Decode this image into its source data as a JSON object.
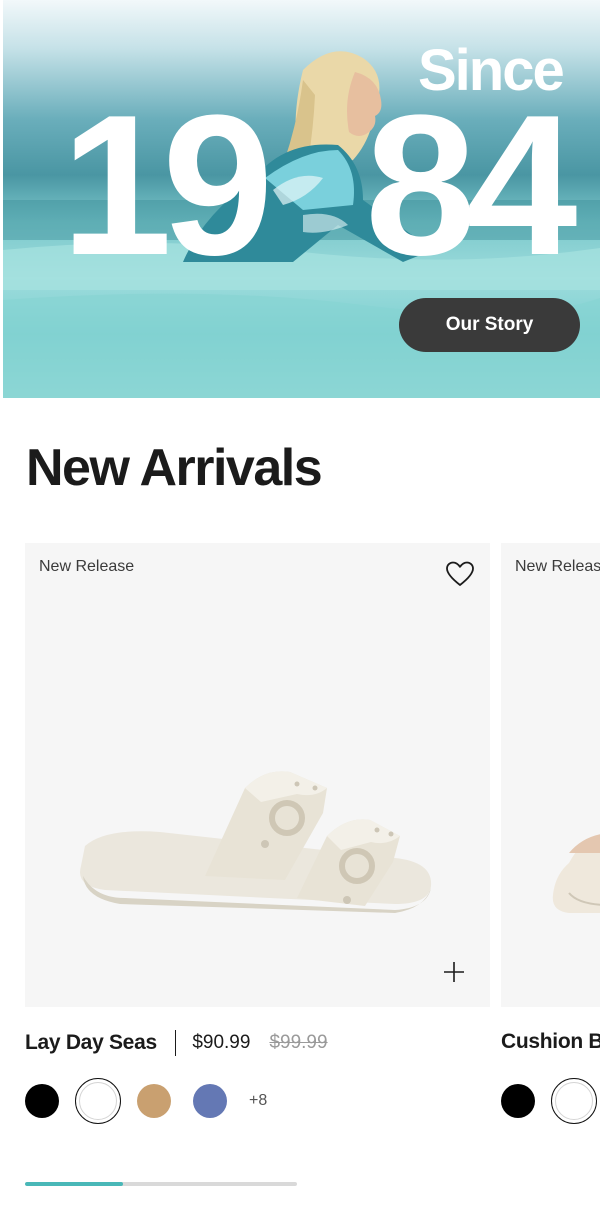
{
  "hero": {
    "since": "Since",
    "year_left": "19",
    "year_right": "84",
    "cta_label": "Our Story"
  },
  "section": {
    "title": "New Arrivals"
  },
  "products": [
    {
      "badge": "New Release",
      "name": "Lay Day Seas",
      "price": "$90.99",
      "original_price": "$99.99",
      "swatches": [
        "#000000",
        "#ffffff",
        "#c9a070",
        "#6478b4"
      ],
      "more_colors": "+8"
    },
    {
      "badge": "New Release",
      "name": "Cushion Bounce",
      "swatches": [
        "#000000",
        "#ffffff"
      ]
    }
  ],
  "icons": {
    "wishlist": "heart-icon",
    "quick_add": "plus-icon"
  },
  "carousel": {
    "progress": 0.36
  },
  "colors": {
    "accent": "#49b8b8",
    "cta_bg": "#3a3a3a"
  }
}
